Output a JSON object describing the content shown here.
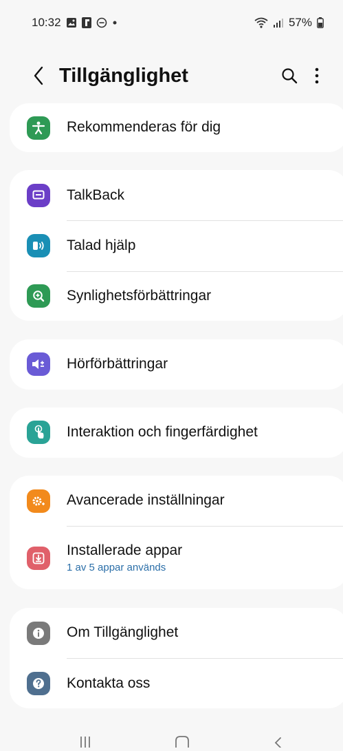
{
  "status_bar": {
    "time": "10:32",
    "battery": "57%",
    "icons_left": [
      "gallery-icon",
      "flipboard-icon",
      "do-not-disturb-icon",
      "dot-icon"
    ],
    "icons_right": [
      "wifi-icon",
      "signal-icon",
      "battery-icon"
    ]
  },
  "header": {
    "title": "Tillgänglighet"
  },
  "sections": [
    {
      "items": [
        {
          "label": "Rekommenderas för dig",
          "icon": "accessibility-person-icon",
          "color": "#2e9a55"
        }
      ]
    },
    {
      "items": [
        {
          "label": "TalkBack",
          "icon": "talkback-icon",
          "color": "#6b3ec7"
        },
        {
          "label": "Talad hjälp",
          "icon": "spoken-assistance-icon",
          "color": "#1a8fb5"
        },
        {
          "label": "Synlighetsförbättringar",
          "icon": "magnify-plus-icon",
          "color": "#2e9a55"
        }
      ]
    },
    {
      "items": [
        {
          "label": "Hörförbättringar",
          "icon": "hearing-icon",
          "color": "#6a5bd6"
        }
      ]
    },
    {
      "items": [
        {
          "label": "Interaktion och fingerfärdighet",
          "icon": "touch-hand-icon",
          "color": "#2aa396"
        }
      ]
    },
    {
      "items": [
        {
          "label": "Avancerade inställningar",
          "icon": "advanced-gear-icon",
          "color": "#f28a1c"
        },
        {
          "label": "Installerade appar",
          "sub": "1 av 5 appar används",
          "icon": "installed-apps-icon",
          "color": "#e0606a"
        }
      ]
    },
    {
      "items": [
        {
          "label": "Om Tillgänglighet",
          "icon": "info-icon",
          "color": "#7a7a7a"
        },
        {
          "label": "Kontakta oss",
          "icon": "help-icon",
          "color": "#4f6f8f"
        }
      ]
    }
  ],
  "nav_bar": {
    "buttons": [
      "recents-icon",
      "home-icon",
      "back-icon"
    ]
  }
}
